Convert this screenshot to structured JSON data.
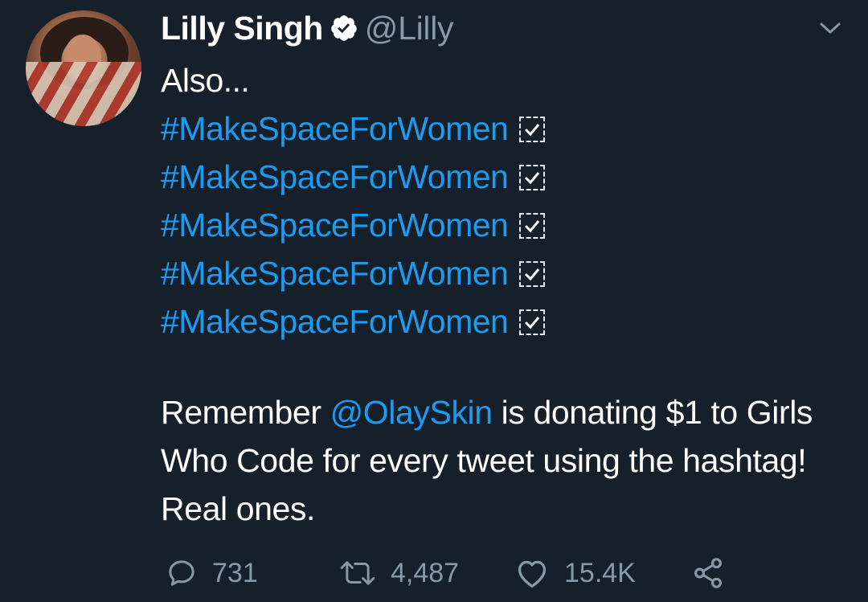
{
  "author": {
    "name": "Lilly Singh",
    "handle": "@Lilly",
    "verified": true,
    "avatar_icon": "profile-photo"
  },
  "tweet": {
    "intro": "Also...",
    "hashtag_lines": [
      {
        "tag": "#MakeSpaceForWomen",
        "emoji": "ballot-box-with-check"
      },
      {
        "tag": "#MakeSpaceForWomen",
        "emoji": "ballot-box-with-check"
      },
      {
        "tag": "#MakeSpaceForWomen",
        "emoji": "ballot-box-with-check"
      },
      {
        "tag": "#MakeSpaceForWomen",
        "emoji": "ballot-box-with-check"
      },
      {
        "tag": "#MakeSpaceForWomen",
        "emoji": "ballot-box-with-check"
      }
    ],
    "paragraph": {
      "before_mention": "Remember ",
      "mention": "@OlaySkin",
      "after_mention": " is donating $1 to Girls Who Code for every tweet using the hashtag! Real ones."
    }
  },
  "actions": {
    "reply_count": "731",
    "retweet_count": "4,487",
    "like_count": "15.4K"
  },
  "colors": {
    "background": "#15202b",
    "link": "#1d9bf0",
    "secondary_text": "#8899a6"
  }
}
